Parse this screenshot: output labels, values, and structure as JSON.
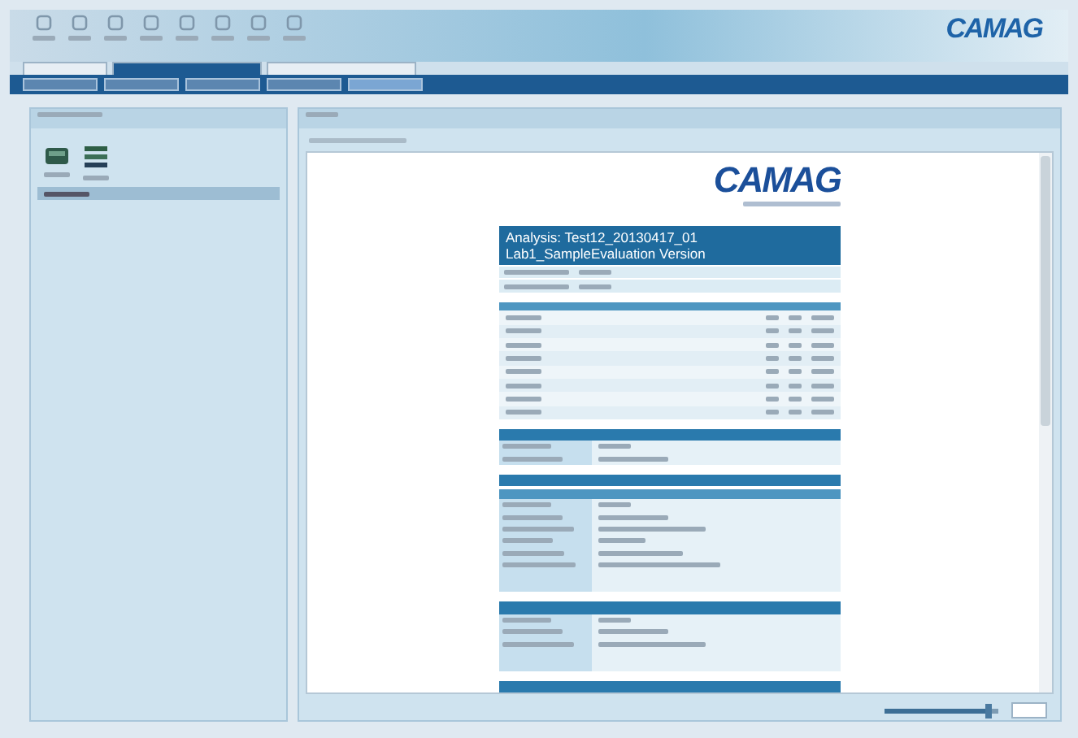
{
  "header": {
    "logo": "CAMAG"
  },
  "tabs": [
    {
      "selected": false
    },
    {
      "selected": true
    },
    {
      "selected": false
    }
  ],
  "report": {
    "logo": "CAMAG",
    "title_lines": [
      "Analysis: Test12_20130417_01",
      "Lab1_SampleEvaluation Version"
    ]
  },
  "zoom_slider": {
    "level": 0.92
  }
}
